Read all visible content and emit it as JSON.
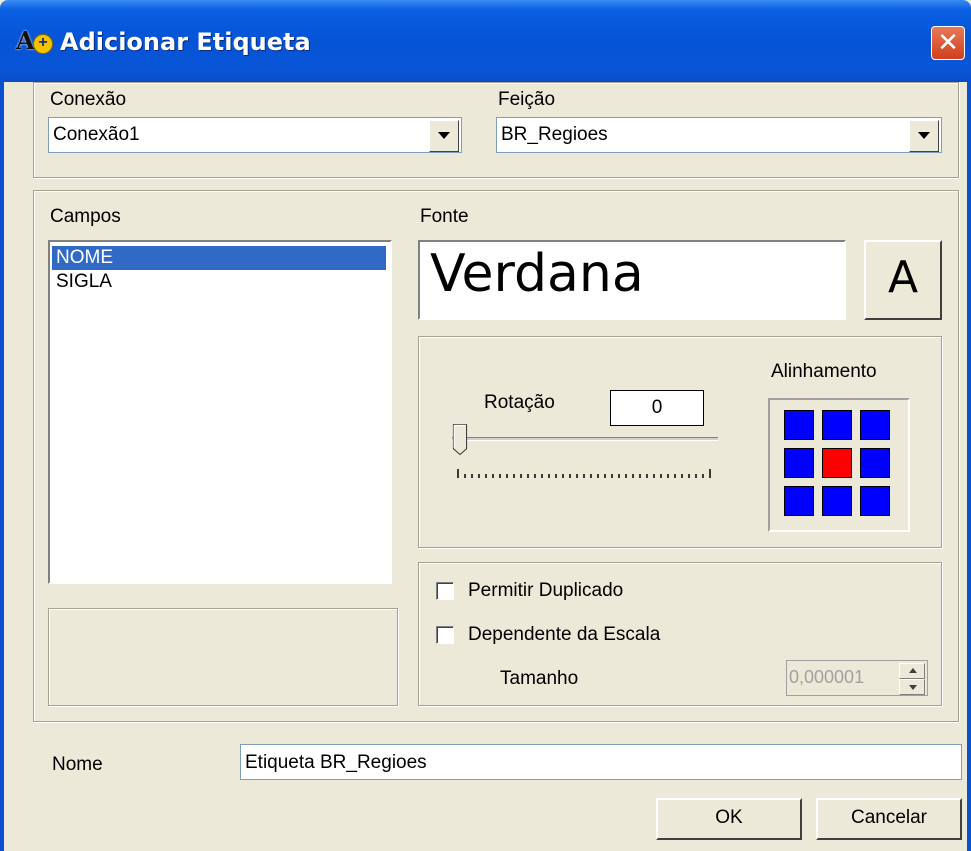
{
  "window": {
    "title": "Adicionar Etiqueta",
    "close_glyph": "✕"
  },
  "conexao": {
    "label": "Conexão",
    "value": "Conexão1"
  },
  "feicao": {
    "label": "Feição",
    "value": "BR_Regioes"
  },
  "campos": {
    "label": "Campos",
    "items": [
      "NOME",
      "SIGLA"
    ],
    "selected_index": 0
  },
  "fonte": {
    "label": "Fonte",
    "preview_text": "Verdana",
    "button_glyph": "A"
  },
  "rotacao": {
    "label": "Rotação",
    "value": "0",
    "slider_value": 0,
    "slider_min": 0,
    "slider_max": 360
  },
  "alinhamento": {
    "label": "Alinhamento",
    "selected_cell": 4,
    "cell_color": "#0000ff",
    "selected_color": "#ff0000"
  },
  "options": {
    "permitir_duplicado": {
      "label": "Permitir Duplicado",
      "checked": false
    },
    "dependente_escala": {
      "label": "Dependente da Escala",
      "checked": false
    },
    "tamanho": {
      "label": "Tamanho",
      "value": "0,000001",
      "enabled": false
    }
  },
  "nome": {
    "label": "Nome",
    "value": "Etiqueta BR_Regioes"
  },
  "buttons": {
    "ok": "OK",
    "cancel": "Cancelar"
  }
}
